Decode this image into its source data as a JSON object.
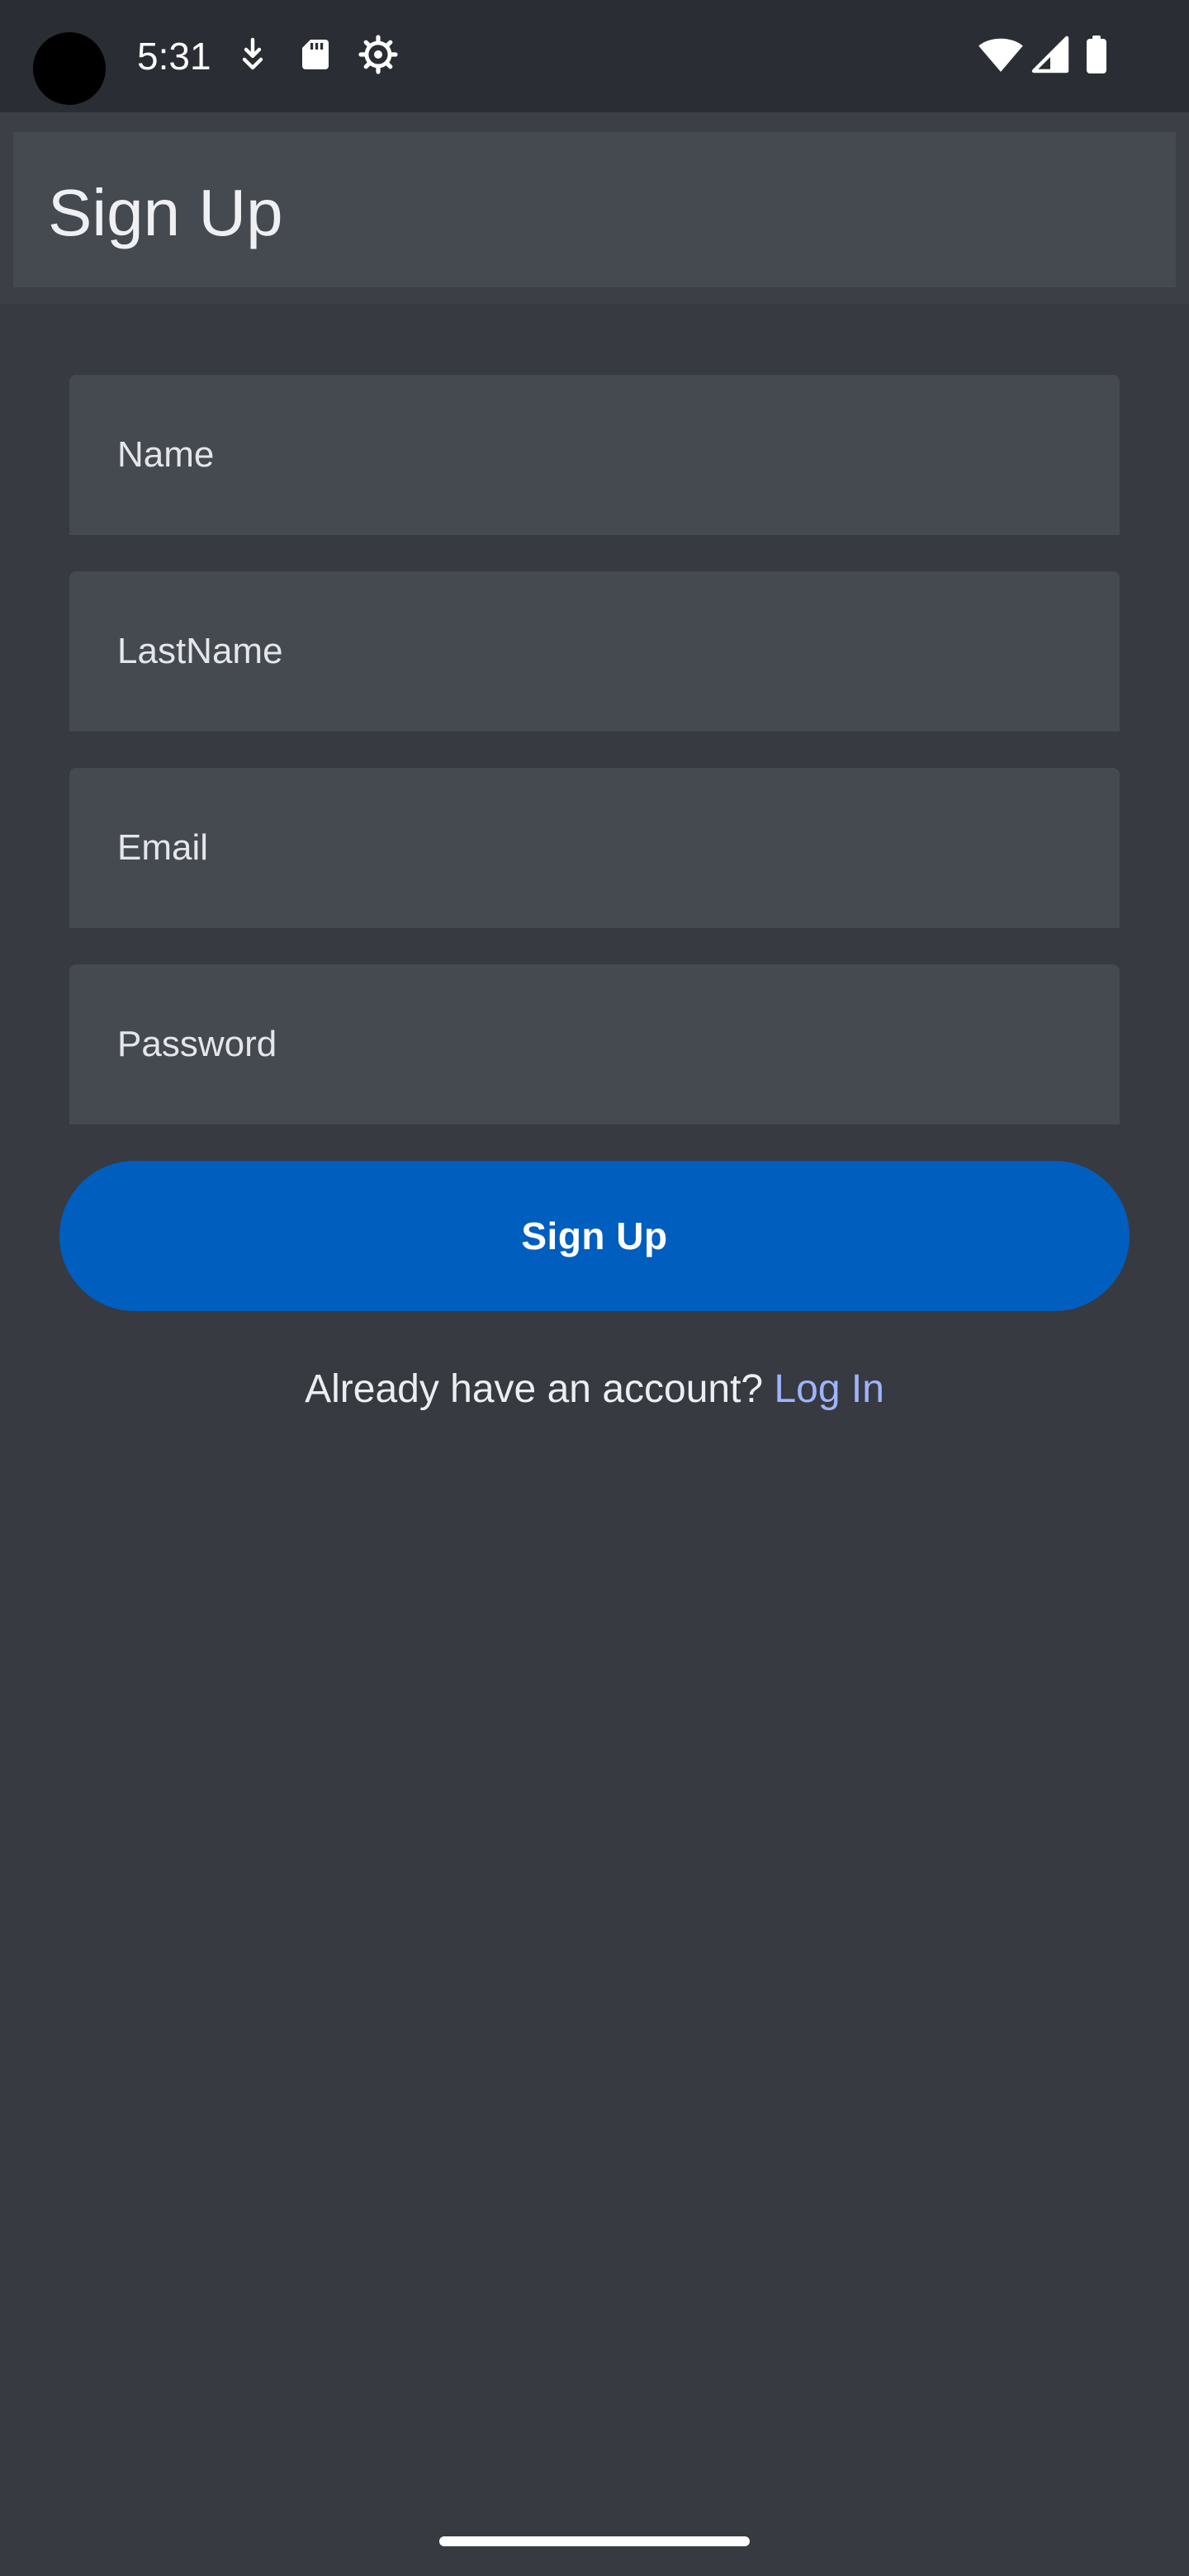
{
  "status_bar": {
    "time": "5:31",
    "left_icons": [
      "download-icon",
      "sd-card-icon",
      "settings-gear-icon"
    ],
    "right_icons": [
      "wifi-icon",
      "cellular-signal-icon",
      "battery-icon"
    ]
  },
  "app_bar": {
    "title": "Sign Up"
  },
  "form": {
    "name_placeholder": "Name",
    "lastname_placeholder": "LastName",
    "email_placeholder": "Email",
    "password_placeholder": "Password",
    "name_value": "",
    "lastname_value": "",
    "email_value": "",
    "password_value": ""
  },
  "actions": {
    "signup_label": "Sign Up",
    "login_prompt": "Already have an account?",
    "login_link": "Log In"
  },
  "colors": {
    "background": "#373a40",
    "status_bar": "#2a2d33",
    "surface": "#454950",
    "primary_button": "#005ebf",
    "link": "#9fb4ff"
  }
}
